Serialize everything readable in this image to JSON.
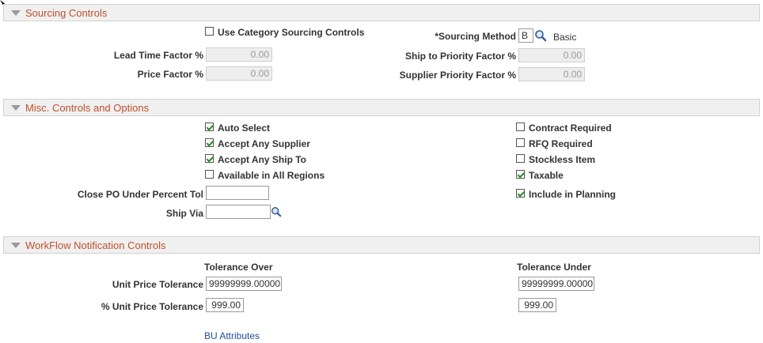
{
  "sourcing": {
    "title": "Sourcing Controls",
    "use_category_label": "Use Category Sourcing Controls",
    "use_category_checked": false,
    "sourcing_method_label": "*Sourcing Method",
    "sourcing_method_value": "B",
    "sourcing_method_desc": "Basic",
    "lead_time_label": "Lead Time Factor %",
    "lead_time_value": "0.00",
    "price_factor_label": "Price Factor %",
    "price_factor_value": "0.00",
    "ship_to_priority_label": "Ship to Priority Factor %",
    "ship_to_priority_value": "0.00",
    "supplier_priority_label": "Supplier Priority Factor %",
    "supplier_priority_value": "0.00"
  },
  "misc": {
    "title": "Misc. Controls and Options",
    "auto_select": "Auto Select",
    "accept_any_supplier": "Accept Any Supplier",
    "accept_any_ship_to": "Accept Any Ship To",
    "available_all_regions": "Available in All Regions",
    "contract_required": "Contract Required",
    "rfq_required": "RFQ Required",
    "stockless_item": "Stockless Item",
    "taxable": "Taxable",
    "include_in_planning": "Include in Planning",
    "close_po_label": "Close PO Under Percent Tol",
    "close_po_value": "",
    "ship_via_label": "Ship Via",
    "ship_via_value": ""
  },
  "workflow": {
    "title": "WorkFlow Notification Controls",
    "tol_over_label": "Tolerance Over",
    "tol_under_label": "Tolerance Under",
    "unit_price_tol_label": "Unit Price Tolerance",
    "unit_price_tol_over": "99999999.00000",
    "unit_price_tol_under": "99999999.00000",
    "pct_unit_price_tol_label": "% Unit Price Tolerance",
    "pct_unit_price_tol_over": "999.00",
    "pct_unit_price_tol_under": "999.00"
  },
  "bu_attributes_link": "BU Attributes",
  "colors": {
    "section_title": "#c0502b",
    "link": "#1f4e9c",
    "check": "#2a8a2a"
  }
}
